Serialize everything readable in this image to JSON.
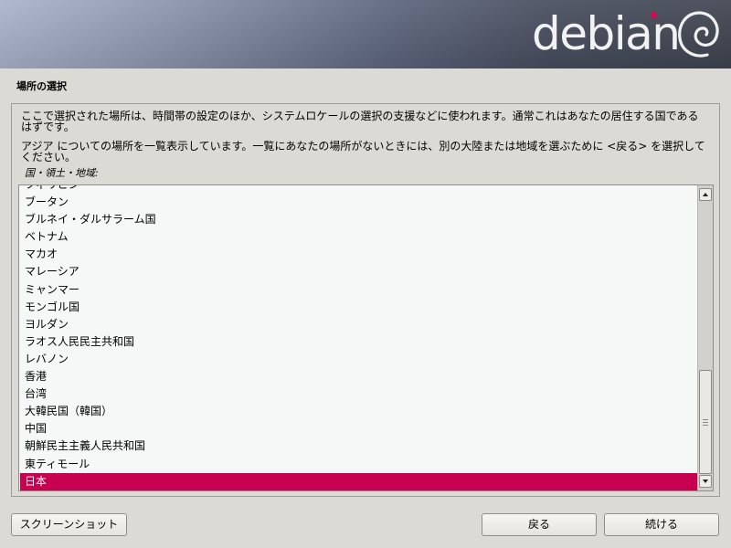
{
  "banner": {
    "logo_text": "debian"
  },
  "page": {
    "title": "場所の選択",
    "paragraph1": "ここで選択された場所は、時間帯の設定のほか、システムロケールの選択の支援などに使われます。通常これはあなたの居住する国であるはずです。",
    "paragraph2": "アジア についての場所を一覧表示しています。一覧にあなたの場所がないときには、別の大陸または地域を選ぶために <戻る> を選択してください。",
    "list_label": "国・領土・地域:"
  },
  "list": {
    "items": [
      "フィリピン",
      "ブータン",
      "ブルネイ・ダルサラーム国",
      "ベトナム",
      "マカオ",
      "マレーシア",
      "ミャンマー",
      "モンゴル国",
      "ヨルダン",
      "ラオス人民民主共和国",
      "レバノン",
      "香港",
      "台湾",
      "大韓民国（韓国）",
      "中国",
      "朝鮮民主主義人民共和国",
      "東ティモール",
      "日本"
    ],
    "selected": "日本"
  },
  "buttons": {
    "screenshot": "スクリーンショット",
    "back": "戻る",
    "continue": "続ける"
  },
  "colors": {
    "selection": "#c70050",
    "logo_dot": "#d70751"
  }
}
